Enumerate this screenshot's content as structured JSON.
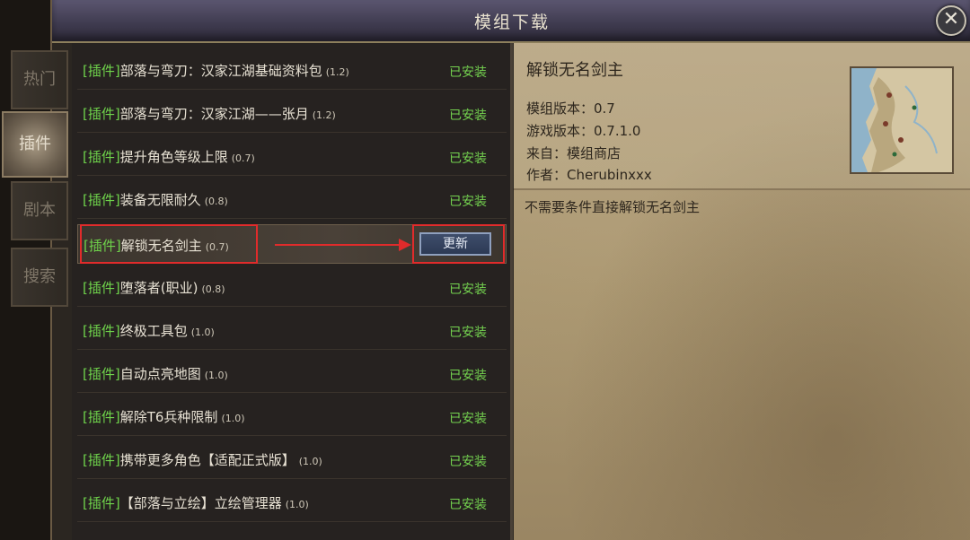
{
  "window": {
    "title": "模组下载",
    "close_glyph": "✕"
  },
  "side_tabs": [
    {
      "label": "热门",
      "active": false
    },
    {
      "label": "插件",
      "active": true
    },
    {
      "label": "剧本",
      "active": false
    },
    {
      "label": "搜索",
      "active": false
    }
  ],
  "mod_list": [
    {
      "tag": "[插件]",
      "name": "部落与弯刀：汉家江湖基础资料包",
      "version": "(1.2)",
      "status": "已安装"
    },
    {
      "tag": "[插件]",
      "name": "部落与弯刀：汉家江湖——张月",
      "version": "(1.2)",
      "status": "已安装"
    },
    {
      "tag": "[插件]",
      "name": "提升角色等级上限",
      "version": "(0.7)",
      "status": "已安装"
    },
    {
      "tag": "[插件]",
      "name": "装备无限耐久",
      "version": "(0.8)",
      "status": "已安装"
    },
    {
      "tag": "[插件]",
      "name": "解锁无名剑主",
      "version": "(0.7)",
      "status": "",
      "button": "更新"
    },
    {
      "tag": "[插件]",
      "name": "堕落者(职业)",
      "version": "(0.8)",
      "status": "已安装"
    },
    {
      "tag": "[插件]",
      "name": "终极工具包",
      "version": "(1.0)",
      "status": "已安装"
    },
    {
      "tag": "[插件]",
      "name": "自动点亮地图",
      "version": "(1.0)",
      "status": "已安装"
    },
    {
      "tag": "[插件]",
      "name": "解除T6兵种限制",
      "version": "(1.0)",
      "status": "已安装"
    },
    {
      "tag": "[插件]",
      "name": "携带更多角色【适配正式版】",
      "version": "(1.0)",
      "status": "已安装"
    },
    {
      "tag": "[插件]",
      "name": "【部落与立绘】立绘管理器",
      "version": "(1.0)",
      "status": "已安装"
    }
  ],
  "detail": {
    "title": "解锁无名剑主",
    "mod_version": "模组版本：0.7",
    "game_version": "游戏版本：0.7.1.0",
    "source": "来自：模组商店",
    "author": "作者：Cherubinxxx",
    "description": "不需要条件直接解锁无名剑主"
  },
  "colors": {
    "installed_green": "#74d24f",
    "tag_green": "#6fd34b",
    "highlight_red": "#e12b2b"
  }
}
